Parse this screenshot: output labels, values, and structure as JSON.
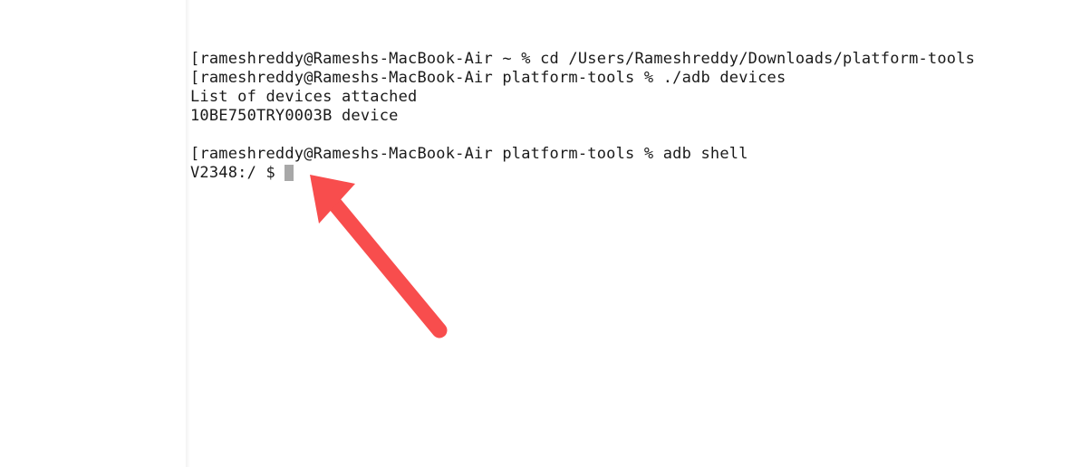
{
  "terminal": {
    "lines": [
      {
        "prefix": "[",
        "prompt": "rameshreddy@Rameshs-MacBook-Air ~ %",
        "command": " cd /Users/Rameshreddy/Downloads/platform-tools"
      },
      {
        "prefix": "[",
        "prompt": "rameshreddy@Rameshs-MacBook-Air platform-tools %",
        "command": " ./adb devices"
      },
      {
        "text": "List of devices attached"
      },
      {
        "text": "10BE750TRY0003B device"
      },
      {
        "blank": true
      },
      {
        "prefix": "[",
        "prompt": "rameshreddy@Rameshs-MacBook-Air platform-tools %",
        "command": " adb shell"
      },
      {
        "shell_prompt": "V2348:/ $ ",
        "has_cursor": true
      }
    ]
  },
  "annotation": {
    "type": "arrow",
    "color": "#f84d4d"
  }
}
